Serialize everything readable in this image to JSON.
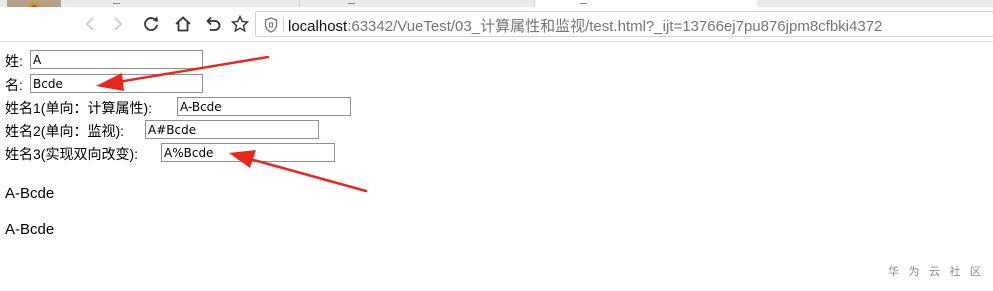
{
  "browser": {
    "url_host": "localhost",
    "url_rest": ":63342/VueTest/03_计算属性和监视/test.html?_ijt=13766ej7pu876jpm8cfbki4372",
    "icons": [
      "back-icon",
      "forward-icon",
      "reload-icon",
      "home-icon",
      "undo-icon",
      "star-icon",
      "shield-icon"
    ]
  },
  "form": {
    "surname_label": "姓:",
    "surname_value": "A",
    "given_label": "名:",
    "given_value": "Bcde",
    "full1_label": "姓名1(单向：计算属性):",
    "full1_value": "A-Bcde",
    "full2_label": "姓名2(单向：监视):",
    "full2_value": "A#Bcde",
    "full3_label": "姓名3(实现双向改变):",
    "full3_value": "A%Bcde"
  },
  "output": {
    "line1": "A-Bcde",
    "line2": "A-Bcde"
  },
  "annotation_color": "#e8281f",
  "watermark": "华 为 云 社 区"
}
